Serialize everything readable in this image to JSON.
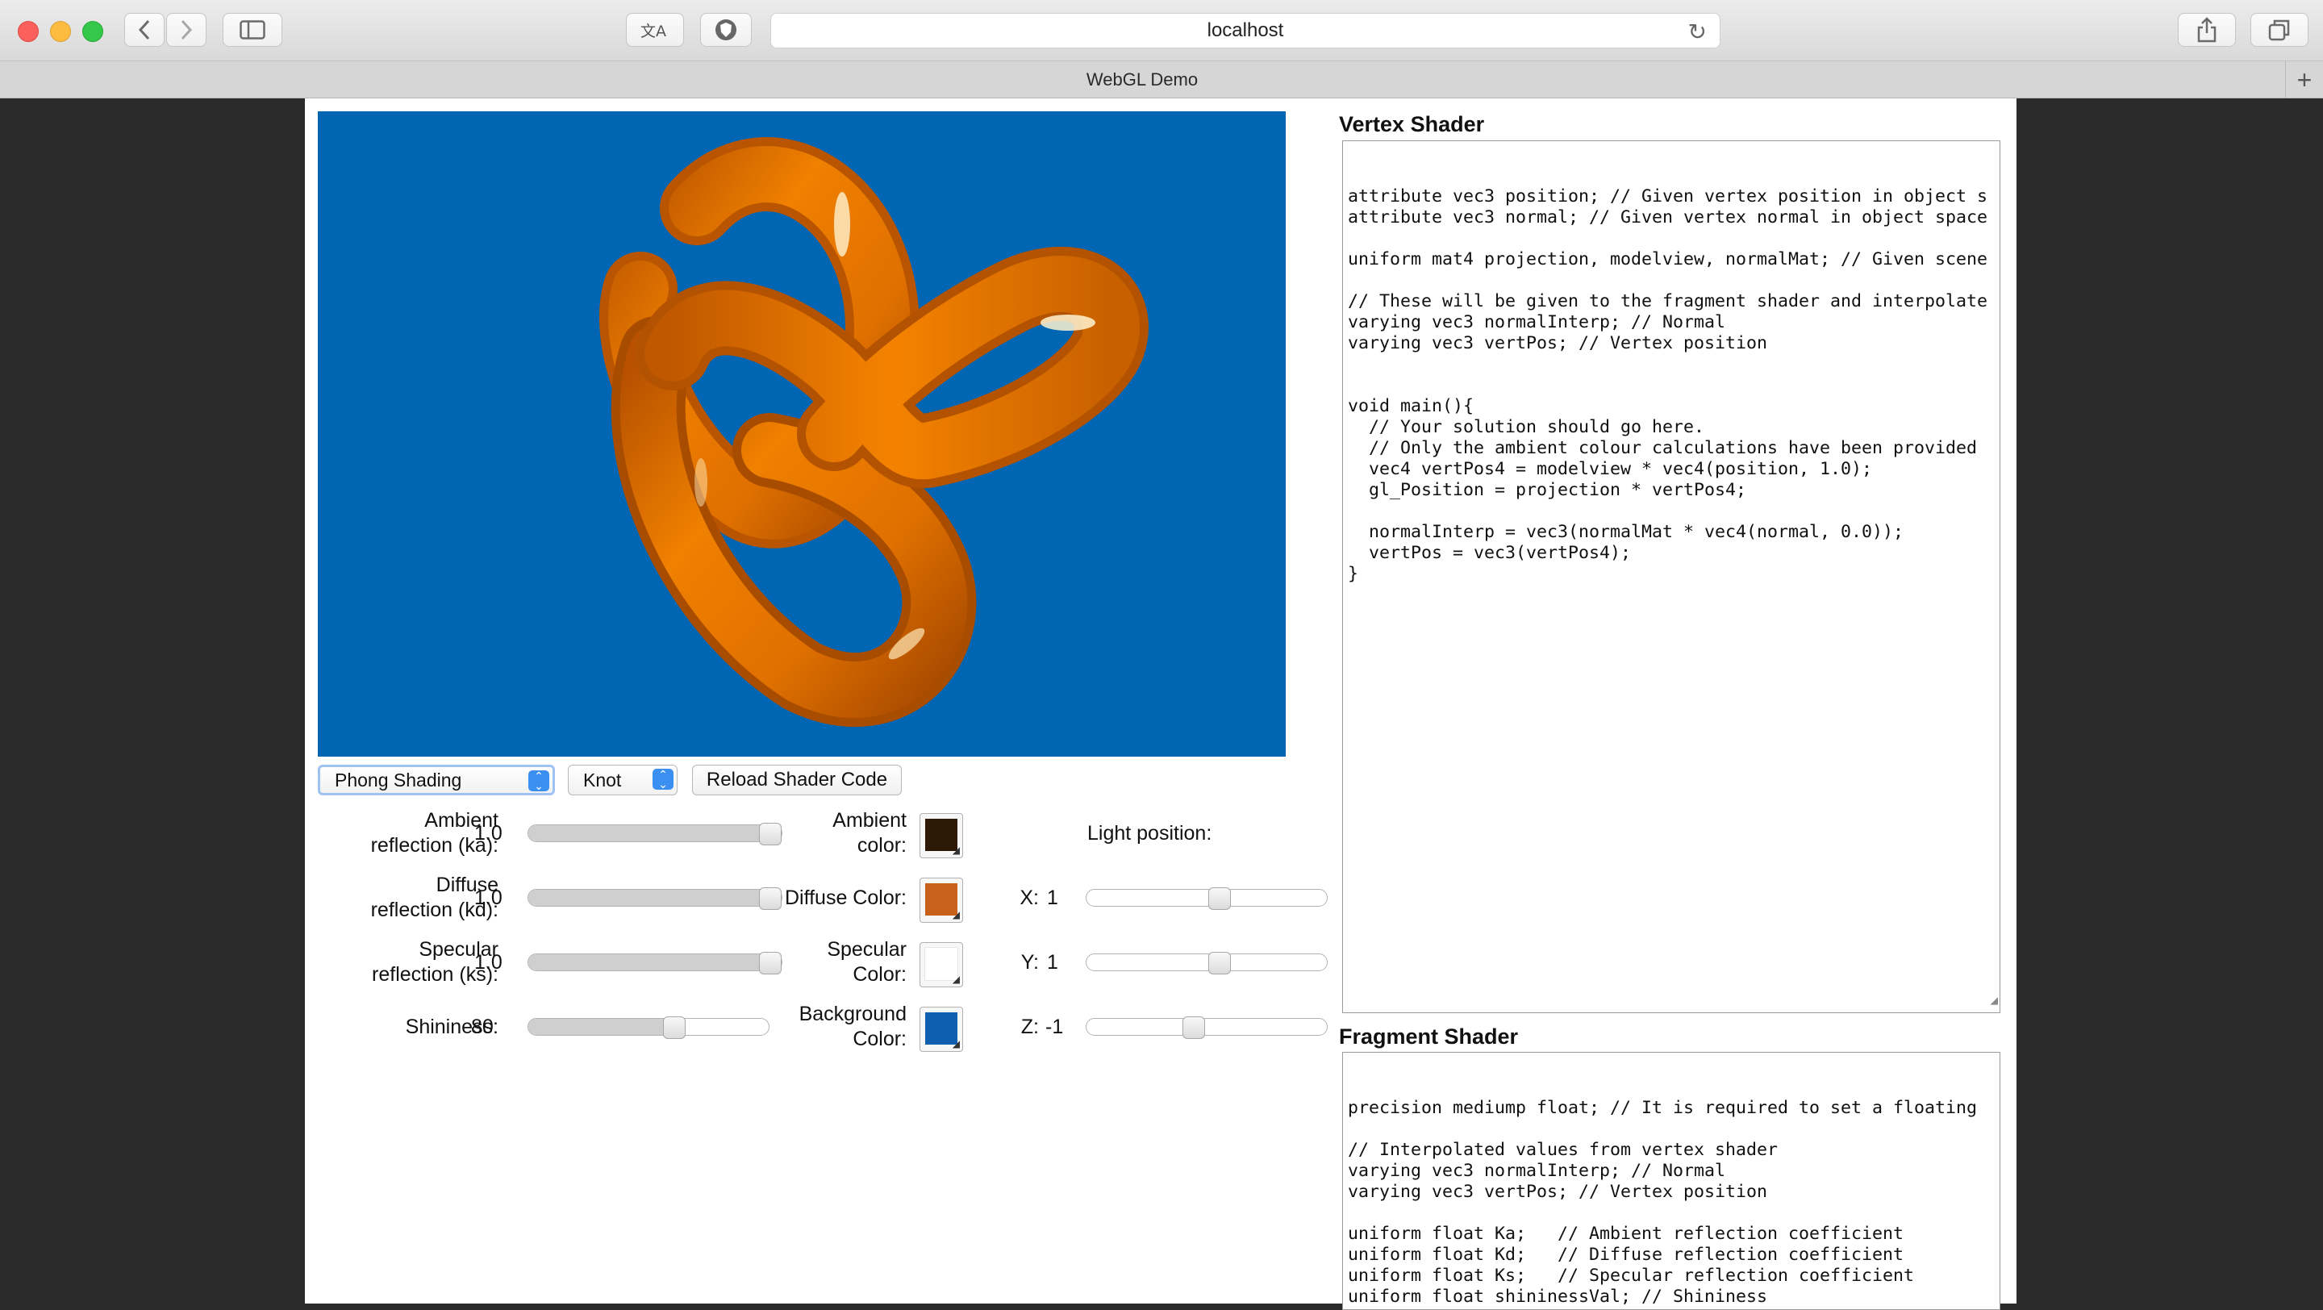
{
  "browser": {
    "url": "localhost",
    "tab_title": "WebGL Demo"
  },
  "scene": {
    "background_color": "#0066b4",
    "object_color": "#ef7a00"
  },
  "controls": {
    "shading_select": "Phong Shading",
    "model_select": "Knot",
    "reload_button": "Reload Shader Code"
  },
  "params": {
    "ambient": {
      "label_1": "Ambient",
      "label_2": "reflection (ka):",
      "value": "1.0",
      "level": 1.0
    },
    "diffuse": {
      "label_1": "Diffuse",
      "label_2": "reflection (kd):",
      "value": "1.0",
      "level": 1.0
    },
    "specular": {
      "label_1": "Specular",
      "label_2": "reflection (ks):",
      "value": "1.0",
      "level": 1.0
    },
    "shininess": {
      "label": "Shininess:",
      "value": "80",
      "level": 0.62
    }
  },
  "colors": {
    "ambient": {
      "label_1": "Ambient",
      "label_2": "color:",
      "value": "#2e1806"
    },
    "diffuse": {
      "label": "Diffuse Color:",
      "value": "#c8611c"
    },
    "specular": {
      "label_1": "Specular",
      "label_2": "Color:",
      "value": "#ffffff"
    },
    "background": {
      "label_1": "Background",
      "label_2": "Color:",
      "value": "#0f5fb0"
    }
  },
  "light": {
    "title": "Light position:",
    "x": {
      "label": "X:",
      "value": "1",
      "level": 0.56
    },
    "y": {
      "label": "Y:",
      "value": "1",
      "level": 0.56
    },
    "z": {
      "label": "Z:",
      "value": "-1",
      "level": 0.44
    }
  },
  "vertex_shader": {
    "heading": "Vertex Shader",
    "code": "attribute vec3 position; // Given vertex position in object s\nattribute vec3 normal; // Given vertex normal in object space\n\nuniform mat4 projection, modelview, normalMat; // Given scene\n\n// These will be given to the fragment shader and interpolate\nvarying vec3 normalInterp; // Normal\nvarying vec3 vertPos; // Vertex position\n\n\nvoid main(){\n  // Your solution should go here.\n  // Only the ambient colour calculations have been provided\n  vec4 vertPos4 = modelview * vec4(position, 1.0);\n  gl_Position = projection * vertPos4;\n\n  normalInterp = vec3(normalMat * vec4(normal, 0.0));\n  vertPos = vec3(vertPos4);\n}"
  },
  "fragment_shader": {
    "heading": "Fragment Shader",
    "code": "precision mediump float; // It is required to set a floating\n\n// Interpolated values from vertex shader\nvarying vec3 normalInterp; // Normal\nvarying vec3 vertPos; // Vertex position\n\nuniform float Ka;   // Ambient reflection coefficient\nuniform float Kd;   // Diffuse reflection coefficient\nuniform float Ks;   // Specular reflection coefficient\nuniform float shininessVal; // Shininess\n\n// Material color"
  }
}
